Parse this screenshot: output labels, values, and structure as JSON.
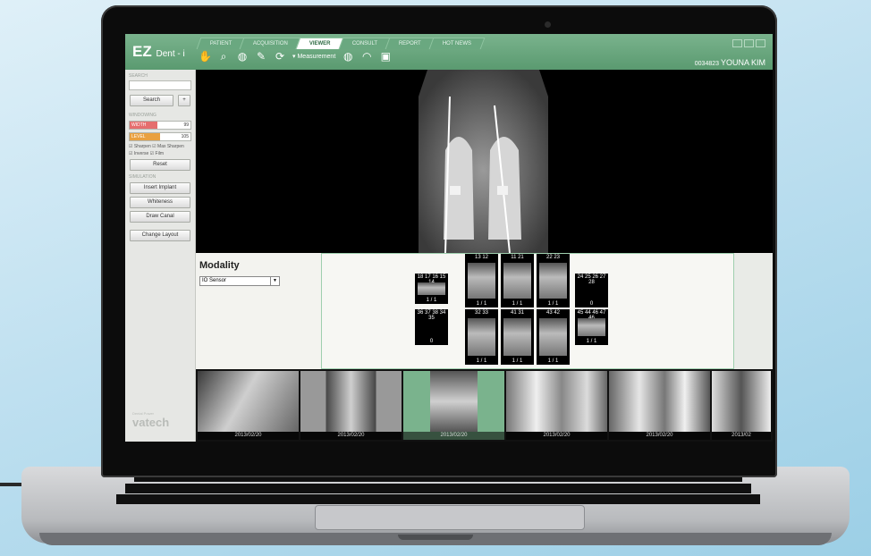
{
  "app": {
    "logo": "EZ",
    "logo_suffix": "Dent - i",
    "tabs": [
      "PATIENT",
      "ACQUISITION",
      "VIEWER",
      "CONSULT",
      "REPORT",
      "HOT NEWS"
    ],
    "active_tab": "VIEWER",
    "toolbar": {
      "measurement_label": "Measurement"
    },
    "patient_id": "0034823",
    "patient_name": "YOUNA KIM"
  },
  "sidebar": {
    "search_title": "SEARCH",
    "search_button": "Search",
    "plus_button": "+",
    "windowing_title": "WINDOWING",
    "width": {
      "label": "WIDTH",
      "value": "99",
      "fill": 0.45,
      "color": "#e56e6e"
    },
    "level": {
      "label": "LEVEL",
      "value": "105",
      "fill": 0.5,
      "color": "#e9a040"
    },
    "checks": [
      "Sharpen",
      "Max Sharpen",
      "Inverse",
      "Film"
    ],
    "reset_button": "Reset",
    "simulation_title": "SIMULATION",
    "sim_buttons": [
      "Insert Implant",
      "Whiteness",
      "Draw Canal"
    ],
    "change_layout_button": "Change Layout",
    "brand_small": "Dental Power",
    "brand": "vatech"
  },
  "modality": {
    "label": "Modality",
    "value": "IO Sensor"
  },
  "tooth_chart": [
    {
      "top": "18 17 16 15 14",
      "bottom": "1 / 1"
    },
    {
      "top": "13 12",
      "bottom": "1 / 1"
    },
    {
      "top": "11 21",
      "bottom": "1 / 1"
    },
    {
      "top": "22 23",
      "bottom": "1 / 1"
    },
    {
      "top": "24 25 26 27 28",
      "bottom": "0"
    },
    {
      "top": "36 37 38 34 35",
      "bottom": "0"
    },
    {
      "top": "32 33",
      "bottom": "1 / 1"
    },
    {
      "top": "41 31",
      "bottom": "1 / 1"
    },
    {
      "top": "43 42",
      "bottom": "1 / 1"
    },
    {
      "top": "45 44 46 47 46",
      "bottom": "1 / 1"
    }
  ],
  "thumbnails": [
    {
      "date": "2013/02/20"
    },
    {
      "date": "2013/02/20"
    },
    {
      "date": "2013/02/20"
    },
    {
      "date": "2013/02/20"
    },
    {
      "date": "2013/02/20"
    },
    {
      "date": "2013/02"
    }
  ],
  "colors": {
    "brand_green": "#5a9a70",
    "selected_green": "#7ab38d"
  }
}
